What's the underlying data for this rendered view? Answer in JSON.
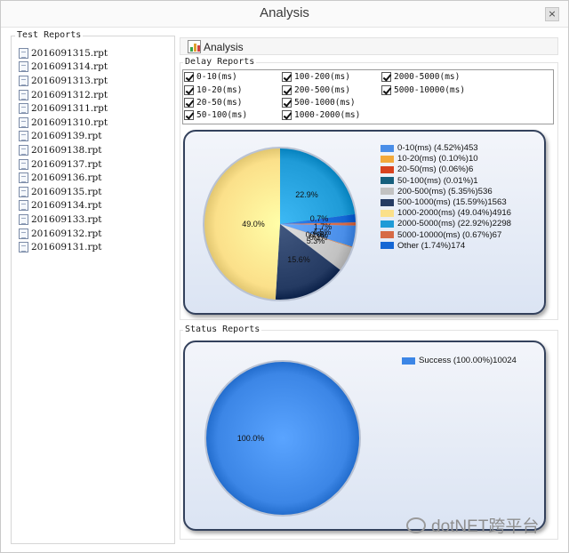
{
  "window": {
    "title": "Analysis",
    "close_glyph": "×"
  },
  "test_reports": {
    "label": "Test Reports",
    "files": [
      "2016091315.rpt",
      "2016091314.rpt",
      "2016091313.rpt",
      "2016091312.rpt",
      "2016091311.rpt",
      "2016091310.rpt",
      "201609139.rpt",
      "201609138.rpt",
      "201609137.rpt",
      "201609136.rpt",
      "201609135.rpt",
      "201609134.rpt",
      "201609133.rpt",
      "201609132.rpt",
      "201609131.rpt"
    ]
  },
  "toolbar": {
    "analysis_label": "Analysis",
    "icon": "chart-icon"
  },
  "delay_reports": {
    "label": "Delay  Reports",
    "checkboxes": [
      {
        "label": "0-10(ms)",
        "checked": true
      },
      {
        "label": "10-20(ms)",
        "checked": true
      },
      {
        "label": "20-50(ms)",
        "checked": true
      },
      {
        "label": "50-100(ms)",
        "checked": true
      },
      {
        "label": "100-200(ms)",
        "checked": true
      },
      {
        "label": "200-500(ms)",
        "checked": true
      },
      {
        "label": "500-1000(ms)",
        "checked": true
      },
      {
        "label": "1000-2000(ms)",
        "checked": true
      },
      {
        "label": "2000-5000(ms)",
        "checked": true
      },
      {
        "label": "5000-10000(ms)",
        "checked": true
      }
    ]
  },
  "status_reports": {
    "label": "Status Reports"
  },
  "chart_data": [
    {
      "type": "pie",
      "legend_position": "right",
      "slices": [
        {
          "legend": "0-10(ms) (4.52%)453",
          "value": 4.52,
          "count": 453,
          "color": "#4a8ee8"
        },
        {
          "legend": "10-20(ms) (0.10%)10",
          "value": 0.1,
          "count": 10,
          "color": "#f2a93b"
        },
        {
          "legend": "20-50(ms) (0.06%)6",
          "value": 0.06,
          "count": 6,
          "color": "#d8431f"
        },
        {
          "legend": "50-100(ms) (0.01%)1",
          "value": 0.01,
          "count": 1,
          "color": "#16607e"
        },
        {
          "legend": "200-500(ms) (5.35%)536",
          "value": 5.35,
          "count": 536,
          "color": "#c2c2c2"
        },
        {
          "legend": "500-1000(ms) (15.59%)1563",
          "value": 15.59,
          "count": 1563,
          "color": "#243a62"
        },
        {
          "legend": "1000-2000(ms) (49.04%)4916",
          "value": 49.04,
          "count": 4916,
          "color": "#fbe08a"
        },
        {
          "legend": "2000-5000(ms) (22.92%)2298",
          "value": 22.92,
          "count": 2298,
          "color": "#1f9bd7"
        },
        {
          "legend": "5000-10000(ms) (0.67%)67",
          "value": 0.67,
          "count": 67,
          "color": "#d66a46"
        },
        {
          "legend": "Other (1.74%)174",
          "value": 1.74,
          "count": 174,
          "color": "#1466d4"
        }
      ],
      "pie_labels": [
        {
          "text": "22.9%",
          "slice": 7
        },
        {
          "text": "49.0%",
          "slice": 6
        },
        {
          "text": "15.6%",
          "slice": 5
        },
        {
          "text": "5.3%",
          "slice": 4
        },
        {
          "text": "0.7%",
          "slice": 8
        },
        {
          "text": "1.7%",
          "slice": 9
        },
        {
          "text": "4.5%",
          "slice": 0
        },
        {
          "text": "0.1%",
          "slice": 1
        },
        {
          "text": "0.1%",
          "slice": 2
        },
        {
          "text": "0.0%",
          "slice": 3
        }
      ]
    },
    {
      "type": "pie",
      "legend_position": "top-right",
      "slices": [
        {
          "legend": "Success (100.00%)10024",
          "value": 100.0,
          "count": 10024,
          "color": "#3c86e6"
        }
      ],
      "pie_labels": [
        {
          "text": "100.0%",
          "slice": 0
        }
      ]
    }
  ]
}
